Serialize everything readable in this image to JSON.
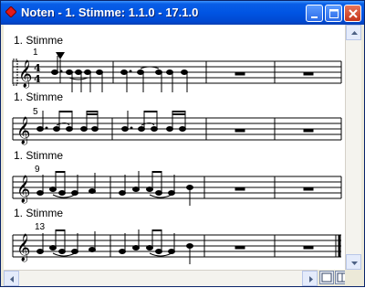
{
  "window": {
    "title": "Noten - 1. Stimme:  1.1.0 - 17.1.0",
    "icon": "red-diamond-icon",
    "controls": [
      "minimize-icon",
      "maximize-icon",
      "close-icon"
    ]
  },
  "score": {
    "systems": [
      {
        "label": "1. Stimme",
        "measure_number": "1"
      },
      {
        "label": "1. Stimme",
        "measure_number": "5"
      },
      {
        "label": "1. Stimme",
        "measure_number": "9"
      },
      {
        "label": "1. Stimme",
        "measure_number": "13"
      }
    ],
    "time_signature": "4/4",
    "clef": "treble-clef-icon"
  },
  "scrollbars": {
    "vertical": [
      "scroll-up-icon",
      "scroll-down-icon"
    ],
    "horizontal": [
      "scroll-left-icon",
      "scroll-right-icon"
    ]
  },
  "view_buttons": [
    "page-view-icon",
    "split-view-icon"
  ]
}
